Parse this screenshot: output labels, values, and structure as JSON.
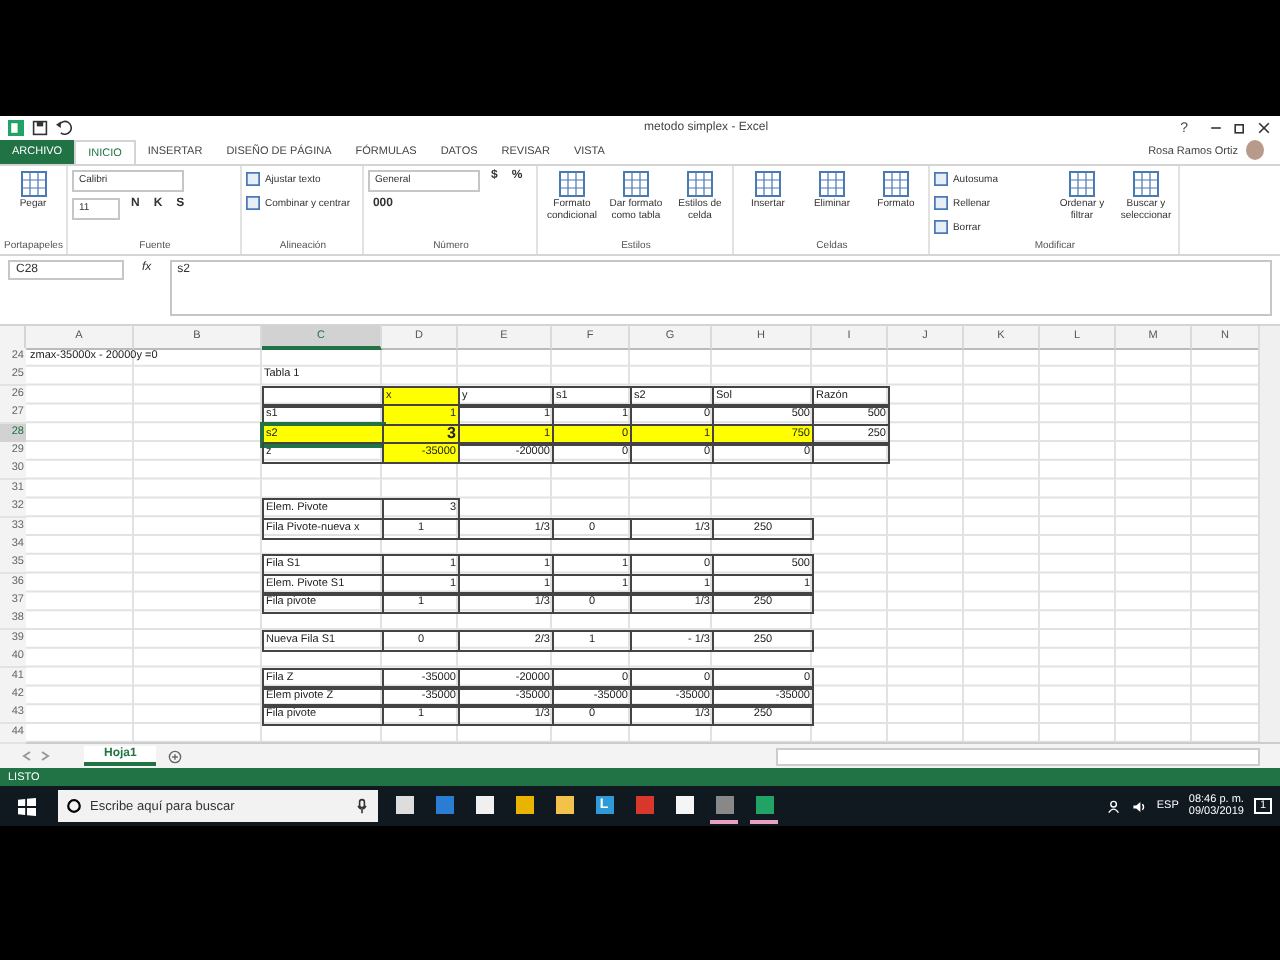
{
  "window": {
    "title": "metodo simplex - Excel",
    "help": "?",
    "user": "Rosa Ramos Ortiz"
  },
  "ribbon": {
    "tabs": [
      {
        "label": "ARCHIVO",
        "kind": "file",
        "selected": false
      },
      {
        "label": "INICIO",
        "kind": "tab",
        "selected": true
      },
      {
        "label": "INSERTAR",
        "kind": "tab",
        "selected": false
      },
      {
        "label": "DISEÑO DE PÁGINA",
        "kind": "tab",
        "selected": false
      },
      {
        "label": "FÓRMULAS",
        "kind": "tab",
        "selected": false
      },
      {
        "label": "DATOS",
        "kind": "tab",
        "selected": false
      },
      {
        "label": "REVISAR",
        "kind": "tab",
        "selected": false
      },
      {
        "label": "VISTA",
        "kind": "tab",
        "selected": false
      }
    ],
    "groups": [
      {
        "label": "Portapapeles",
        "items": [
          {
            "kind": "big",
            "label": "Pegar"
          }
        ]
      },
      {
        "label": "Fuente",
        "items": [
          {
            "kind": "field",
            "value": "Calibri"
          },
          {
            "kind": "field",
            "value": "11"
          },
          {
            "kind": "glyph",
            "label": "N"
          },
          {
            "kind": "glyph",
            "label": "K"
          },
          {
            "kind": "glyph",
            "label": "S"
          }
        ]
      },
      {
        "label": "Alineación",
        "items": [
          {
            "kind": "small",
            "label": "Ajustar texto"
          },
          {
            "kind": "small",
            "label": "Combinar y centrar"
          }
        ]
      },
      {
        "label": "Número",
        "items": [
          {
            "kind": "field",
            "value": "General"
          },
          {
            "kind": "glyph",
            "label": "$"
          },
          {
            "kind": "glyph",
            "label": "%"
          },
          {
            "kind": "glyph",
            "label": "000"
          }
        ]
      },
      {
        "label": "Estilos",
        "items": [
          {
            "kind": "big",
            "label": "Formato condicional"
          },
          {
            "kind": "big",
            "label": "Dar formato como tabla"
          },
          {
            "kind": "big",
            "label": "Estilos de celda"
          }
        ]
      },
      {
        "label": "Celdas",
        "items": [
          {
            "kind": "big",
            "label": "Insertar"
          },
          {
            "kind": "big",
            "label": "Eliminar"
          },
          {
            "kind": "big",
            "label": "Formato"
          }
        ]
      },
      {
        "label": "Modificar",
        "items": [
          {
            "kind": "small",
            "label": "Autosuma"
          },
          {
            "kind": "small",
            "label": "Rellenar"
          },
          {
            "kind": "small",
            "label": "Borrar"
          },
          {
            "kind": "big",
            "label": "Ordenar y filtrar"
          },
          {
            "kind": "big",
            "label": "Buscar y seleccionar"
          }
        ]
      }
    ]
  },
  "formula_bar": {
    "name_box": "C28",
    "fx": "fx",
    "value": "s2"
  },
  "grid": {
    "columns": [
      {
        "label": "A",
        "selected": false
      },
      {
        "label": "B",
        "selected": false
      },
      {
        "label": "C",
        "selected": true
      },
      {
        "label": "D",
        "selected": false
      },
      {
        "label": "E",
        "selected": false
      },
      {
        "label": "F",
        "selected": false
      },
      {
        "label": "G",
        "selected": false
      },
      {
        "label": "H",
        "selected": false
      },
      {
        "label": "I",
        "selected": false
      },
      {
        "label": "J",
        "selected": false
      },
      {
        "label": "K",
        "selected": false
      },
      {
        "label": "L",
        "selected": false
      },
      {
        "label": "M",
        "selected": false
      },
      {
        "label": "N",
        "selected": false
      }
    ],
    "rows": [
      {
        "n": "24",
        "selected": false,
        "note": "zmax-35000x - 20000y =0",
        "cells": [
          null,
          null,
          null,
          null,
          null,
          null,
          null
        ]
      },
      {
        "n": "25",
        "selected": false,
        "cells": [
          {
            "text": "Tabla 1",
            "kind": "label",
            "highlighted": false,
            "bold": false,
            "bordered": false,
            "selected": false
          },
          null,
          null,
          null,
          null,
          null,
          null
        ]
      },
      {
        "n": "26",
        "selected": false,
        "cells": [
          {
            "kind": "label",
            "highlighted": false,
            "bold": false,
            "bordered": true,
            "selected": false
          },
          {
            "text": "x",
            "kind": "label",
            "highlighted": true,
            "bold": false,
            "bordered": true,
            "selected": false
          },
          {
            "text": "y",
            "kind": "label",
            "highlighted": false,
            "bold": false,
            "bordered": true,
            "selected": false
          },
          {
            "text": "s1",
            "kind": "label",
            "highlighted": false,
            "bold": false,
            "bordered": true,
            "selected": false
          },
          {
            "text": "s2",
            "kind": "label",
            "highlighted": false,
            "bold": false,
            "bordered": true,
            "selected": false
          },
          {
            "text": "Sol",
            "kind": "label",
            "highlighted": false,
            "bold": false,
            "bordered": true,
            "selected": false
          },
          {
            "text": "Razón",
            "kind": "label",
            "highlighted": false,
            "bold": false,
            "bordered": true,
            "selected": false
          }
        ]
      },
      {
        "n": "27",
        "selected": false,
        "cells": [
          {
            "text": "s1",
            "kind": "label",
            "highlighted": false,
            "bold": false,
            "bordered": true,
            "selected": false
          },
          {
            "text": "1",
            "kind": "number",
            "highlighted": true,
            "bold": false,
            "bordered": true,
            "selected": false
          },
          {
            "text": "1",
            "kind": "number",
            "highlighted": false,
            "bold": false,
            "bordered": true,
            "selected": false
          },
          {
            "text": "1",
            "kind": "number",
            "highlighted": false,
            "bold": false,
            "bordered": true,
            "selected": false
          },
          {
            "text": "0",
            "kind": "number",
            "highlighted": false,
            "bold": false,
            "bordered": true,
            "selected": false
          },
          {
            "text": "500",
            "kind": "number",
            "highlighted": false,
            "bold": false,
            "bordered": true,
            "selected": false
          },
          {
            "text": "500",
            "kind": "number",
            "highlighted": false,
            "bold": false,
            "bordered": true,
            "selected": false
          }
        ]
      },
      {
        "n": "28",
        "selected": true,
        "cells": [
          {
            "text": "s2",
            "kind": "label",
            "highlighted": true,
            "bold": false,
            "bordered": true,
            "selected": true
          },
          {
            "text": "3",
            "kind": "number",
            "highlighted": true,
            "bold": true,
            "bordered": true,
            "selected": false
          },
          {
            "text": "1",
            "kind": "number",
            "highlighted": true,
            "bold": false,
            "bordered": true,
            "selected": false
          },
          {
            "text": "0",
            "kind": "number",
            "highlighted": true,
            "bold": false,
            "bordered": true,
            "selected": false
          },
          {
            "text": "1",
            "kind": "number",
            "highlighted": true,
            "bold": false,
            "bordered": true,
            "selected": false
          },
          {
            "text": "750",
            "kind": "number",
            "highlighted": true,
            "bold": false,
            "bordered": true,
            "selected": false
          },
          {
            "text": "250",
            "kind": "number",
            "highlighted": false,
            "bold": false,
            "bordered": true,
            "selected": false
          }
        ]
      },
      {
        "n": "29",
        "selected": false,
        "cells": [
          {
            "text": "z",
            "kind": "label",
            "highlighted": false,
            "bold": false,
            "bordered": true,
            "selected": false
          },
          {
            "text": "-35000",
            "kind": "number",
            "highlighted": true,
            "bold": false,
            "bordered": true,
            "selected": false
          },
          {
            "text": "-20000",
            "kind": "number",
            "highlighted": false,
            "bold": false,
            "bordered": true,
            "selected": false
          },
          {
            "text": "0",
            "kind": "number",
            "highlighted": false,
            "bold": false,
            "bordered": true,
            "selected": false
          },
          {
            "text": "0",
            "kind": "number",
            "highlighted": false,
            "bold": false,
            "bordered": true,
            "selected": false
          },
          {
            "text": "0",
            "kind": "number",
            "highlighted": false,
            "bold": false,
            "bordered": true,
            "selected": false
          },
          {
            "kind": "label",
            "highlighted": false,
            "bold": false,
            "bordered": true,
            "selected": false
          }
        ]
      },
      {
        "n": "30",
        "selected": false,
        "cells": [
          null,
          null,
          null,
          null,
          null,
          null,
          null
        ]
      },
      {
        "n": "31",
        "selected": false,
        "cells": [
          null,
          null,
          null,
          null,
          null,
          null,
          null
        ]
      },
      {
        "n": "32",
        "selected": false,
        "cells": [
          {
            "text": "Elem. Pivote",
            "kind": "label",
            "highlighted": false,
            "bold": false,
            "bordered": true,
            "selected": false
          },
          {
            "text": "3",
            "kind": "number",
            "highlighted": false,
            "bold": false,
            "bordered": true,
            "selected": false
          },
          null,
          null,
          null,
          null,
          null
        ]
      },
      {
        "n": "33",
        "selected": false,
        "cells": [
          {
            "text": "Fila Pivote-nueva x",
            "kind": "label",
            "highlighted": false,
            "bold": false,
            "bordered": true,
            "selected": false
          },
          {
            "text": "1",
            "kind": "centered",
            "highlighted": false,
            "bold": false,
            "bordered": true,
            "selected": false
          },
          {
            "text": "1/3",
            "kind": "number",
            "highlighted": false,
            "bold": false,
            "bordered": true,
            "selected": false
          },
          {
            "text": "0",
            "kind": "centered",
            "highlighted": false,
            "bold": false,
            "bordered": true,
            "selected": false
          },
          {
            "text": "1/3",
            "kind": "number",
            "highlighted": false,
            "bold": false,
            "bordered": true,
            "selected": false
          },
          {
            "text": "250",
            "kind": "centered",
            "highlighted": false,
            "bold": false,
            "bordered": true,
            "selected": false
          },
          null
        ]
      },
      {
        "n": "34",
        "selected": false,
        "cells": [
          null,
          null,
          null,
          null,
          null,
          null,
          null
        ]
      },
      {
        "n": "35",
        "selected": false,
        "cells": [
          {
            "text": "Fila S1",
            "kind": "label",
            "highlighted": false,
            "bold": false,
            "bordered": true,
            "selected": false
          },
          {
            "text": "1",
            "kind": "number",
            "highlighted": false,
            "bold": false,
            "bordered": true,
            "selected": false
          },
          {
            "text": "1",
            "kind": "number",
            "highlighted": false,
            "bold": false,
            "bordered": true,
            "selected": false
          },
          {
            "text": "1",
            "kind": "number",
            "highlighted": false,
            "bold": false,
            "bordered": true,
            "selected": false
          },
          {
            "text": "0",
            "kind": "number",
            "highlighted": false,
            "bold": false,
            "bordered": true,
            "selected": false
          },
          {
            "text": "500",
            "kind": "number",
            "highlighted": false,
            "bold": false,
            "bordered": true,
            "selected": false
          },
          null
        ]
      },
      {
        "n": "36",
        "selected": false,
        "cells": [
          {
            "text": "Elem. Pivote S1",
            "kind": "label",
            "highlighted": false,
            "bold": false,
            "bordered": true,
            "selected": false
          },
          {
            "text": "1",
            "kind": "number",
            "highlighted": false,
            "bold": false,
            "bordered": true,
            "selected": false
          },
          {
            "text": "1",
            "kind": "number",
            "highlighted": false,
            "bold": false,
            "bordered": true,
            "selected": false
          },
          {
            "text": "1",
            "kind": "number",
            "highlighted": false,
            "bold": false,
            "bordered": true,
            "selected": false
          },
          {
            "text": "1",
            "kind": "number",
            "highlighted": false,
            "bold": false,
            "bordered": true,
            "selected": false
          },
          {
            "text": "1",
            "kind": "number",
            "highlighted": false,
            "bold": false,
            "bordered": true,
            "selected": false
          },
          null
        ]
      },
      {
        "n": "37",
        "selected": false,
        "cells": [
          {
            "text": "Fila pivote",
            "kind": "label",
            "highlighted": false,
            "bold": false,
            "bordered": true,
            "selected": false
          },
          {
            "text": "1",
            "kind": "centered",
            "highlighted": false,
            "bold": false,
            "bordered": true,
            "selected": false
          },
          {
            "text": "1/3",
            "kind": "number",
            "highlighted": false,
            "bold": false,
            "bordered": true,
            "selected": false
          },
          {
            "text": "0",
            "kind": "centered",
            "highlighted": false,
            "bold": false,
            "bordered": true,
            "selected": false
          },
          {
            "text": "1/3",
            "kind": "number",
            "highlighted": false,
            "bold": false,
            "bordered": true,
            "selected": false
          },
          {
            "text": "250",
            "kind": "centered",
            "highlighted": false,
            "bold": false,
            "bordered": true,
            "selected": false
          },
          null
        ]
      },
      {
        "n": "38",
        "selected": false,
        "cells": [
          null,
          null,
          null,
          null,
          null,
          null,
          null
        ]
      },
      {
        "n": "39",
        "selected": false,
        "cells": [
          {
            "text": "Nueva Fila S1",
            "kind": "label",
            "highlighted": false,
            "bold": false,
            "bordered": true,
            "selected": false
          },
          {
            "text": "0",
            "kind": "centered",
            "highlighted": false,
            "bold": false,
            "bordered": true,
            "selected": false
          },
          {
            "text": "2/3",
            "kind": "number",
            "highlighted": false,
            "bold": false,
            "bordered": true,
            "selected": false
          },
          {
            "text": "1",
            "kind": "centered",
            "highlighted": false,
            "bold": false,
            "bordered": true,
            "selected": false
          },
          {
            "text": "- 1/3",
            "kind": "number",
            "highlighted": false,
            "bold": false,
            "bordered": true,
            "selected": false
          },
          {
            "text": "250",
            "kind": "centered",
            "highlighted": false,
            "bold": false,
            "bordered": true,
            "selected": false
          },
          null
        ]
      },
      {
        "n": "40",
        "selected": false,
        "cells": [
          null,
          null,
          null,
          null,
          null,
          null,
          null
        ]
      },
      {
        "n": "41",
        "selected": false,
        "cells": [
          {
            "text": "Fila Z",
            "kind": "label",
            "highlighted": false,
            "bold": false,
            "bordered": true,
            "selected": false
          },
          {
            "text": "-35000",
            "kind": "number",
            "highlighted": false,
            "bold": false,
            "bordered": true,
            "selected": false
          },
          {
            "text": "-20000",
            "kind": "number",
            "highlighted": false,
            "bold": false,
            "bordered": true,
            "selected": false
          },
          {
            "text": "0",
            "kind": "number",
            "highlighted": false,
            "bold": false,
            "bordered": true,
            "selected": false
          },
          {
            "text": "0",
            "kind": "number",
            "highlighted": false,
            "bold": false,
            "bordered": true,
            "selected": false
          },
          {
            "text": "0",
            "kind": "number",
            "highlighted": false,
            "bold": false,
            "bordered": true,
            "selected": false
          },
          null
        ]
      },
      {
        "n": "42",
        "selected": false,
        "cells": [
          {
            "text": "Elem pivote Z",
            "kind": "label",
            "highlighted": false,
            "bold": false,
            "bordered": true,
            "selected": false
          },
          {
            "text": "-35000",
            "kind": "number",
            "highlighted": false,
            "bold": false,
            "bordered": true,
            "selected": false
          },
          {
            "text": "-35000",
            "kind": "number",
            "highlighted": false,
            "bold": false,
            "bordered": true,
            "selected": false
          },
          {
            "text": "-35000",
            "kind": "number",
            "highlighted": false,
            "bold": false,
            "bordered": true,
            "selected": false
          },
          {
            "text": "-35000",
            "kind": "number",
            "highlighted": false,
            "bold": false,
            "bordered": true,
            "selected": false
          },
          {
            "text": "-35000",
            "kind": "number",
            "highlighted": false,
            "bold": false,
            "bordered": true,
            "selected": false
          },
          null
        ]
      },
      {
        "n": "43",
        "selected": false,
        "cells": [
          {
            "text": "Fila pivote",
            "kind": "label",
            "highlighted": false,
            "bold": false,
            "bordered": true,
            "selected": false
          },
          {
            "text": "1",
            "kind": "centered",
            "highlighted": false,
            "bold": false,
            "bordered": true,
            "selected": false
          },
          {
            "text": "1/3",
            "kind": "number",
            "highlighted": false,
            "bold": false,
            "bordered": true,
            "selected": false
          },
          {
            "text": "0",
            "kind": "centered",
            "highlighted": false,
            "bold": false,
            "bordered": true,
            "selected": false
          },
          {
            "text": "1/3",
            "kind": "number",
            "highlighted": false,
            "bold": false,
            "bordered": true,
            "selected": false
          },
          {
            "text": "250",
            "kind": "centered",
            "highlighted": false,
            "bold": false,
            "bordered": true,
            "selected": false
          },
          null
        ]
      },
      {
        "n": "44",
        "selected": false,
        "cells": [
          null,
          null,
          null,
          null,
          null,
          null,
          null
        ]
      }
    ]
  },
  "sheets": [
    {
      "label": "Hoja1",
      "selected": true
    }
  ],
  "status_bar": {
    "text": "LISTO"
  },
  "taskbar": {
    "search": {
      "placeholder": "Escribe aquí para buscar"
    },
    "apps": [
      {
        "kind": "taskview",
        "open": false
      },
      {
        "kind": "edge",
        "open": false
      },
      {
        "kind": "store",
        "open": false
      },
      {
        "kind": "chrome",
        "open": false
      },
      {
        "kind": "files",
        "open": false
      },
      {
        "kind": "letter",
        "label": "L",
        "open": false
      },
      {
        "kind": "red",
        "open": false
      },
      {
        "kind": "mail",
        "open": false
      },
      {
        "kind": "obs",
        "open": true
      },
      {
        "kind": "excel",
        "open": true
      }
    ],
    "language": "ESP",
    "time": "08:46 p. m.",
    "date": "09/03/2019",
    "notifications": "1"
  }
}
